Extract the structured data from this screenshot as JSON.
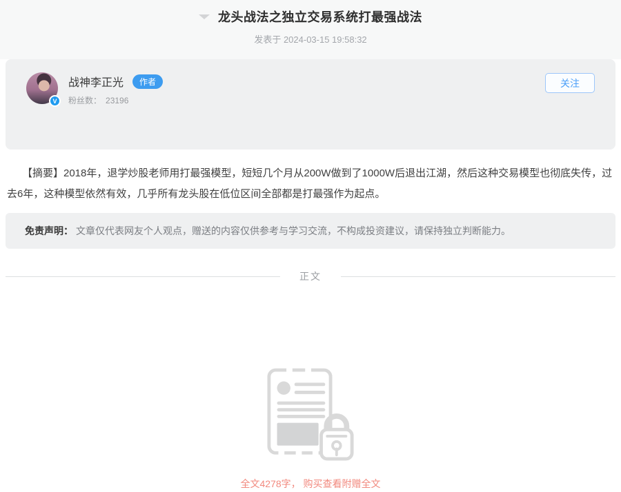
{
  "header": {
    "title": "龙头战法之独立交易系统打最强战法",
    "published": "发表于 2024-03-15 19:58:32"
  },
  "author": {
    "name": "战神李正光",
    "badge": "作者",
    "verified_mark": "V",
    "fans_label": "粉丝数：",
    "fans_count": "23196",
    "follow_label": "关注"
  },
  "abstract": "【摘要】2018年，退学炒股老师用打最强模型，短短几个月从200W做到了1000W后退出江湖，然后这种交易模型也彻底失传，过去6年，这种模型依然有效，几乎所有龙头股在低位区间全部都是打最强作为起点。",
  "disclaimer": {
    "label": "免责声明：",
    "text": "文章仅代表网友个人观点，赠送的内容仅供参考与学习交流，不构成投资建议，请保持独立判断能力。"
  },
  "body_divider_label": "正文",
  "paywall": {
    "notice": "全文4278字， 购买查看附赠全文"
  },
  "colors": {
    "accent_blue": "#3d9cf0",
    "notice_red": "#f2897e",
    "icon_gray": "#d9d9d9"
  }
}
